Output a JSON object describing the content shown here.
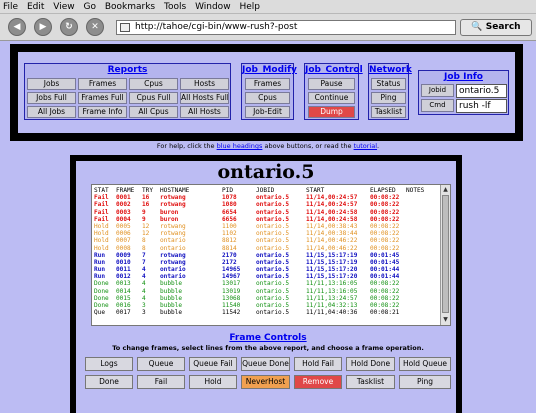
{
  "menu": [
    "File",
    "Edit",
    "View",
    "Go",
    "Bookmarks",
    "Tools",
    "Window",
    "Help"
  ],
  "menu_underline": [
    "F",
    "E",
    "V",
    "G",
    "B",
    "T",
    "W",
    "H"
  ],
  "browser": {
    "url": "http://tahoe/cgi-bin/www-rush?-post",
    "search_label": "Search"
  },
  "groups": {
    "reports": {
      "title": "Reports",
      "buttons": [
        "Jobs",
        "Frames",
        "Cpus",
        "Hosts",
        "Jobs Full",
        "Frames Full",
        "Cpus Full",
        "All Hosts Full",
        "All Jobs",
        "Frame Info",
        "All Cpus",
        "All Hosts"
      ]
    },
    "job_modify": {
      "title": "Job_Modify",
      "buttons": [
        "Frames",
        "Cpus",
        "Job-Edit"
      ]
    },
    "job_control": {
      "title": "Job_Control",
      "buttons": [
        "Pause",
        "Continue",
        "Dump"
      ]
    },
    "network": {
      "title": "Network",
      "buttons": [
        "Status",
        "Ping",
        "Tasklist"
      ]
    },
    "job_info": {
      "title": "Job Info",
      "jobid_label": "Jobid",
      "jobid_value": "ontario.5",
      "cmd_label": "Cmd",
      "cmd_value": "rush -lf"
    }
  },
  "help": {
    "prefix": "For help, click the ",
    "link1": "blue headings",
    "middle": " above buttons, or read the ",
    "link2": "tutorial",
    "suffix": "."
  },
  "report": {
    "title": "ontario.5",
    "header": [
      "STAT",
      "FRAME",
      "TRY",
      "HOSTNAME",
      "PID",
      "JOBID",
      "START",
      "ELAPSED",
      "NOTES"
    ],
    "rows": [
      {
        "stat": "Fail",
        "frame": "0001",
        "try": "16",
        "host": "rotwang",
        "pid": "1078",
        "jobid": "ontario.5",
        "start": "11/14,00:24:57",
        "elapsed": "00:08:22",
        "cls": "c-fail"
      },
      {
        "stat": "Fail",
        "frame": "0002",
        "try": "16",
        "host": "rotwang",
        "pid": "1080",
        "jobid": "ontario.5",
        "start": "11/14,00:24:57",
        "elapsed": "00:08:22",
        "cls": "c-fail"
      },
      {
        "stat": "Fail",
        "frame": "0003",
        "try": "9",
        "host": "buron",
        "pid": "6654",
        "jobid": "ontario.5",
        "start": "11/14,00:24:58",
        "elapsed": "00:08:22",
        "cls": "c-fail"
      },
      {
        "stat": "Fail",
        "frame": "0004",
        "try": "9",
        "host": "buron",
        "pid": "6656",
        "jobid": "ontario.5",
        "start": "11/14,00:24:58",
        "elapsed": "00:08:22",
        "cls": "c-fail"
      },
      {
        "stat": "Hold",
        "frame": "0005",
        "try": "12",
        "host": "rotwang",
        "pid": "1100",
        "jobid": "ontario.5",
        "start": "11/14,00:38:43",
        "elapsed": "00:08:22",
        "cls": "c-hold"
      },
      {
        "stat": "Hold",
        "frame": "0006",
        "try": "12",
        "host": "rotwang",
        "pid": "1102",
        "jobid": "ontario.5",
        "start": "11/14,00:38:44",
        "elapsed": "00:08:22",
        "cls": "c-hold"
      },
      {
        "stat": "Hold",
        "frame": "0007",
        "try": "8",
        "host": "ontario",
        "pid": "8812",
        "jobid": "ontario.5",
        "start": "11/14,00:46:22",
        "elapsed": "00:08:22",
        "cls": "c-hold"
      },
      {
        "stat": "Hold",
        "frame": "0008",
        "try": "8",
        "host": "ontario",
        "pid": "8814",
        "jobid": "ontario.5",
        "start": "11/14,00:46:22",
        "elapsed": "00:08:22",
        "cls": "c-hold"
      },
      {
        "stat": "Run",
        "frame": "0009",
        "try": "7",
        "host": "rotwang",
        "pid": "2170",
        "jobid": "ontario.5",
        "start": "11/15,15:17:19",
        "elapsed": "00:01:45",
        "cls": "c-run"
      },
      {
        "stat": "Run",
        "frame": "0010",
        "try": "7",
        "host": "rotwang",
        "pid": "2172",
        "jobid": "ontario.5",
        "start": "11/15,15:17:19",
        "elapsed": "00:01:45",
        "cls": "c-run"
      },
      {
        "stat": "Run",
        "frame": "0011",
        "try": "4",
        "host": "ontario",
        "pid": "14965",
        "jobid": "ontario.5",
        "start": "11/15,15:17:20",
        "elapsed": "00:01:44",
        "cls": "c-run"
      },
      {
        "stat": "Run",
        "frame": "0012",
        "try": "4",
        "host": "ontario",
        "pid": "14967",
        "jobid": "ontario.5",
        "start": "11/15,15:17:20",
        "elapsed": "00:01:44",
        "cls": "c-run"
      },
      {
        "stat": "Done",
        "frame": "0013",
        "try": "4",
        "host": "bubble",
        "pid": "13017",
        "jobid": "ontario.5",
        "start": "11/11,13:16:05",
        "elapsed": "00:08:22",
        "cls": "c-done"
      },
      {
        "stat": "Done",
        "frame": "0014",
        "try": "4",
        "host": "bubble",
        "pid": "13019",
        "jobid": "ontario.5",
        "start": "11/11,13:16:05",
        "elapsed": "00:08:22",
        "cls": "c-done"
      },
      {
        "stat": "Done",
        "frame": "0015",
        "try": "4",
        "host": "bubble",
        "pid": "13068",
        "jobid": "ontario.5",
        "start": "11/11,13:24:57",
        "elapsed": "00:08:22",
        "cls": "c-done"
      },
      {
        "stat": "Done",
        "frame": "0016",
        "try": "3",
        "host": "bubble",
        "pid": "11540",
        "jobid": "ontario.5",
        "start": "11/11,04:32:13",
        "elapsed": "00:08:22",
        "cls": "c-done"
      },
      {
        "stat": "Que",
        "frame": "0017",
        "try": "3",
        "host": "bubble",
        "pid": "11542",
        "jobid": "ontario.5",
        "start": "11/11,04:40:36",
        "elapsed": "00:08:21",
        "cls": "c-que"
      }
    ]
  },
  "frame_controls": {
    "title": "Frame Controls",
    "desc": "To change frames, select lines from the above report, and choose a frame operation.",
    "row1": [
      "Logs",
      "Queue",
      "Queue Fail",
      "Queue Done",
      "Hold Fail",
      "Hold Done",
      "Hold Queue"
    ],
    "row2": [
      "Done",
      "Fail",
      "Hold",
      "NeverHost",
      "Remove",
      "Tasklist",
      "Ping"
    ]
  },
  "colors": {
    "background": "#bcbcf3",
    "link": "#0000ee",
    "fail": "#e01010",
    "hold": "#e09020",
    "run": "#1010c0",
    "done": "#109010",
    "dump_button": "#e04848",
    "neverhost_button": "#f0a050"
  },
  "icons": [
    "back-arrow-icon",
    "forward-arrow-icon",
    "reload-icon",
    "stop-icon",
    "page-icon",
    "search-icon"
  ]
}
